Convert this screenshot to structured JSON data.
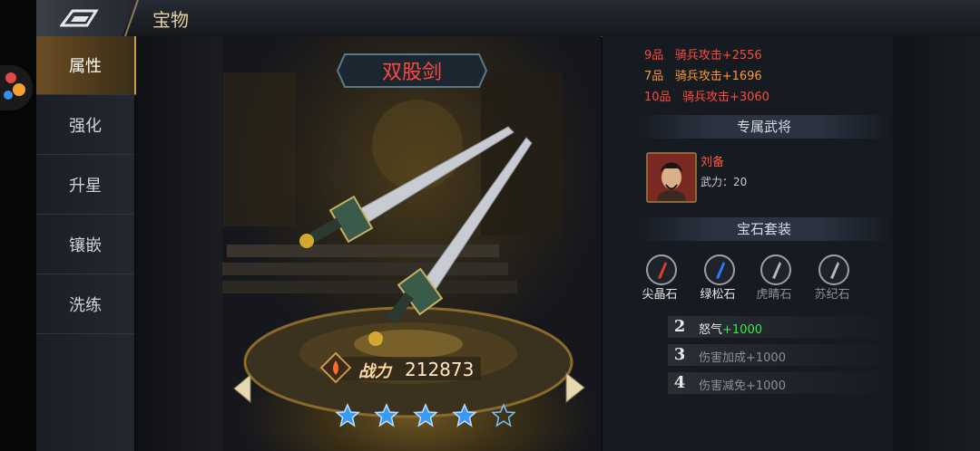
{
  "header": {
    "title": "宝物"
  },
  "sidebar": {
    "tabs": [
      {
        "label": "属性",
        "active": true
      },
      {
        "label": "强化"
      },
      {
        "label": "升星"
      },
      {
        "label": "镶嵌"
      },
      {
        "label": "洗练"
      }
    ]
  },
  "item": {
    "name": "双股剑",
    "power_label": "战力",
    "power_value": "212873",
    "stars_filled": 4,
    "stars_total": 5
  },
  "attributes": [
    {
      "grade": "9品",
      "text": "骑兵攻击+2556",
      "color": "#ff4a3a"
    },
    {
      "grade": "7品",
      "text": "骑兵攻击+1696",
      "color": "#ff9a30"
    },
    {
      "grade": "10品",
      "text": "骑兵攻击+3060",
      "color": "#ff4a3a"
    }
  ],
  "general_section": {
    "title": "专属武将",
    "name": "刘备",
    "power_label": "武力：",
    "power_value": "20"
  },
  "gem_section": {
    "title": "宝石套装",
    "gems": [
      {
        "name": "尖晶石",
        "color": "#e03a3a",
        "active": true
      },
      {
        "name": "绿松石",
        "color": "#2a7cff",
        "active": true
      },
      {
        "name": "虎睛石",
        "color": "#b8b8b8",
        "active": false
      },
      {
        "name": "苏纪石",
        "color": "#b8b8b8",
        "active": false
      }
    ],
    "set_bonuses": [
      {
        "num": "2",
        "label": "怒气",
        "value": "+1000",
        "active": true
      },
      {
        "num": "3",
        "label": "伤害加成+1000",
        "value": "",
        "active": false
      },
      {
        "num": "4",
        "label": "伤害减免+1000",
        "value": "",
        "active": false
      }
    ]
  },
  "colors": {
    "accent_gold": "#c89b4a",
    "active_green": "#3ee84a",
    "inactive_text": "#8a8f98"
  }
}
